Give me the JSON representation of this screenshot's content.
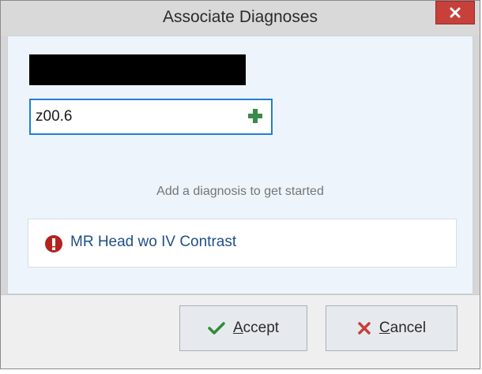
{
  "dialog": {
    "title": "Associate Diagnoses",
    "close_label": "x"
  },
  "search": {
    "value": "z00.6"
  },
  "hint_text": "Add a diagnosis to get started",
  "order": {
    "name": "MR Head wo IV Contrast",
    "alert_icon": "exclamation-circle-icon"
  },
  "buttons": {
    "accept_mnemonic": "A",
    "accept_rest": "ccept",
    "cancel_mnemonic": "C",
    "cancel_rest": "ancel"
  },
  "colors": {
    "close_red": "#c7403a",
    "accent_blue": "#1e7fd8",
    "alert_red": "#b3231e",
    "accept_green": "#2e8b3a",
    "add_green": "#3a8a4a",
    "order_link": "#1f4f86"
  }
}
